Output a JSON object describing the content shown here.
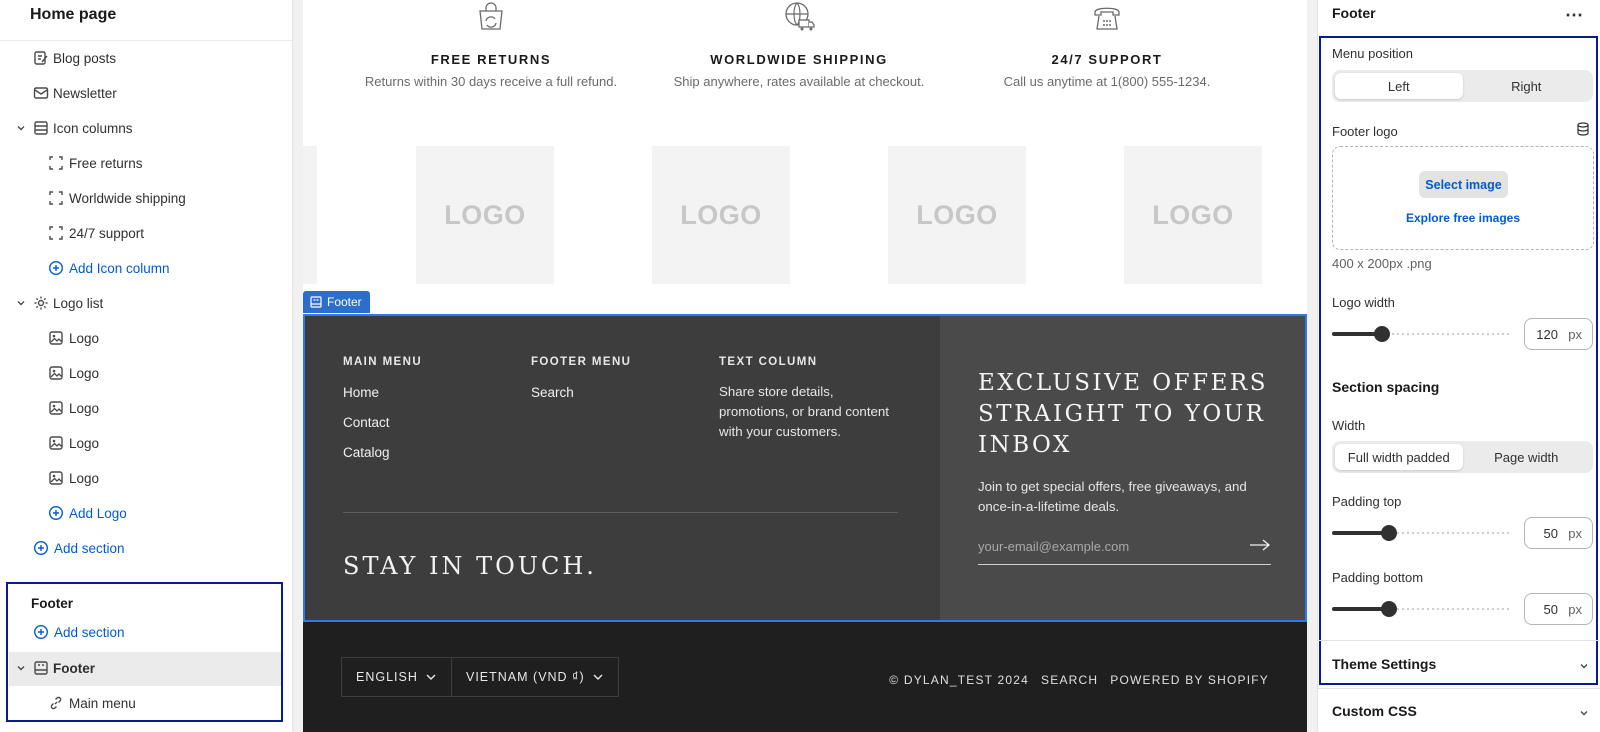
{
  "sidebar": {
    "title": "Home page",
    "items": [
      {
        "label": "Blog posts",
        "icon": "blog-icon"
      },
      {
        "label": "Newsletter",
        "icon": "mail-icon"
      },
      {
        "label": "Icon columns",
        "icon": "columns-icon"
      },
      {
        "label": "Free returns",
        "icon": "block-icon"
      },
      {
        "label": "Worldwide shipping",
        "icon": "block-icon"
      },
      {
        "label": "24/7 support",
        "icon": "block-icon"
      },
      {
        "label": "Add Icon column",
        "icon": "plus-circle-icon"
      },
      {
        "label": "Logo list",
        "icon": "gear-icon"
      },
      {
        "label": "Logo",
        "icon": "image-icon"
      },
      {
        "label": "Logo",
        "icon": "image-icon"
      },
      {
        "label": "Logo",
        "icon": "image-icon"
      },
      {
        "label": "Logo",
        "icon": "image-icon"
      },
      {
        "label": "Logo",
        "icon": "image-icon"
      },
      {
        "label": "Add Logo",
        "icon": "plus-circle-icon"
      },
      {
        "label": "Add section",
        "icon": "plus-circle-icon"
      }
    ],
    "footer_group": {
      "title": "Footer",
      "add_section": "Add section",
      "footer_item": "Footer",
      "main_menu": "Main menu"
    }
  },
  "preview": {
    "features": [
      {
        "title": "FREE RETURNS",
        "text": "Returns within 30 days receive a full refund.",
        "icon": "returns-bag-icon"
      },
      {
        "title": "WORLDWIDE SHIPPING",
        "text": "Ship anywhere, rates available at checkout.",
        "icon": "globe-truck-icon"
      },
      {
        "title": "24/7 SUPPORT",
        "text": "Call us anytime at 1(800) 555-1234.",
        "icon": "phone-icon"
      }
    ],
    "logos": [
      "LOGO",
      "LOGO",
      "LOGO",
      "LOGO"
    ],
    "section_tag": "Footer",
    "footer": {
      "col1_title": "MAIN MENU",
      "col1_links": [
        "Home",
        "Contact",
        "Catalog"
      ],
      "col2_title": "FOOTER MENU",
      "col2_links": [
        "Search"
      ],
      "col3_title": "TEXT COLUMN",
      "col3_text": "Share store details, promotions, or brand content with your customers.",
      "stay": "STAY IN TOUCH.",
      "newsletter_heading": "EXCLUSIVE OFFERS STRAIGHT TO YOUR INBOX",
      "newsletter_text": "Join to get special offers, free giveaways, and once-in-a-lifetime deals.",
      "email_placeholder": "your-email@example.com"
    },
    "bottom": {
      "language": "ENGLISH",
      "country": "VIETNAM (VND ₫)",
      "copyright": "© DYLAN_TEST 2024",
      "search": "SEARCH",
      "powered": "POWERED BY SHOPIFY"
    }
  },
  "panel": {
    "title": "Footer",
    "menu_position_label": "Menu position",
    "menu_position_options": [
      "Left",
      "Right"
    ],
    "menu_position_selected": "Left",
    "footer_logo_label": "Footer logo",
    "select_image": "Select image",
    "explore_images": "Explore free images",
    "logo_hint": "400 x 200px .png",
    "logo_width_label": "Logo width",
    "logo_width_value": "120",
    "logo_width_fraction": 0.26,
    "unit": "px",
    "section_spacing": "Section spacing",
    "width_label": "Width",
    "width_options": [
      "Full width padded",
      "Page width"
    ],
    "width_selected": "Full width padded",
    "padding_top_label": "Padding top",
    "padding_top_value": "50",
    "padding_top_fraction": 0.3,
    "padding_bottom_label": "Padding bottom",
    "padding_bottom_value": "50",
    "padding_bottom_fraction": 0.3,
    "theme_settings": "Theme Settings",
    "custom_css": "Custom CSS"
  },
  "colors": {
    "accent": "#005bd3",
    "highlight_box": "#0a1a8f",
    "section_outline": "#2f7ae5"
  }
}
